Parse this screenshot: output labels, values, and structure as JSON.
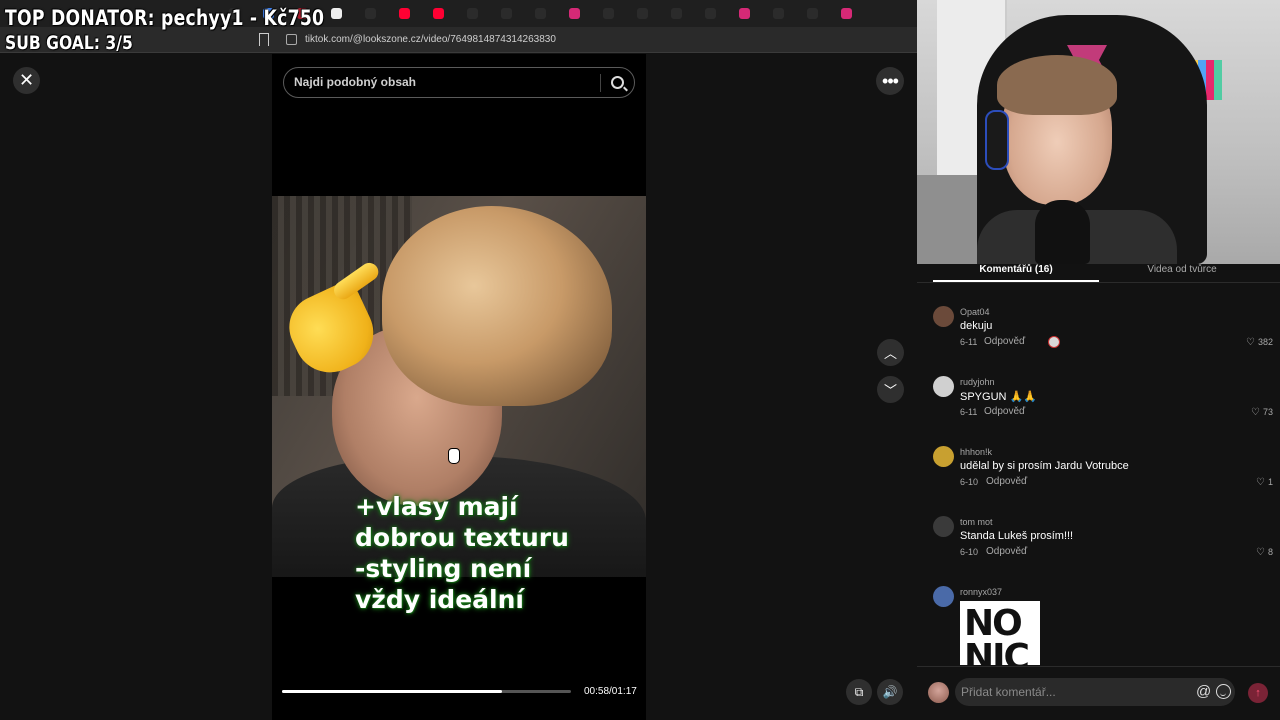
{
  "overlay": {
    "donator": "TOP DONATOR: pechyy1 - Kč750",
    "sub_goal": "SUB GOAL: 3/5"
  },
  "browser": {
    "url": "tiktok.com/@lookszone.cz/video/7649814874314263830",
    "tabs": [
      {
        "icon": "tiktok-icon",
        "color": "#2b2b2b"
      },
      {
        "icon": "google-icon",
        "color": "#4285f4"
      },
      {
        "icon": "site-icon",
        "color": "#b01e2e"
      },
      {
        "icon": "r-icon",
        "color": "#eeeeee"
      },
      {
        "icon": "tiktok-icon",
        "color": "#2b2b2b"
      },
      {
        "icon": "youtube-icon",
        "color": "#ff0033"
      },
      {
        "icon": "youtube-icon",
        "color": "#ff0033"
      },
      {
        "icon": "tiktok-icon",
        "color": "#2b2b2b"
      },
      {
        "icon": "tiktok-icon",
        "color": "#2b2b2b"
      },
      {
        "icon": "tiktok-icon",
        "color": "#2b2b2b"
      },
      {
        "icon": "instagram-icon",
        "color": "#d62976"
      },
      {
        "icon": "tiktok-icon",
        "color": "#2b2b2b"
      },
      {
        "icon": "tiktok-icon",
        "color": "#2b2b2b"
      },
      {
        "icon": "tiktok-icon",
        "color": "#2b2b2b"
      },
      {
        "icon": "tiktok-icon",
        "color": "#2b2b2b"
      },
      {
        "icon": "instagram-icon",
        "color": "#d62976"
      },
      {
        "icon": "tiktok-icon",
        "color": "#2b2b2b"
      },
      {
        "icon": "tiktok-icon",
        "color": "#2b2b2b"
      },
      {
        "icon": "instagram-icon",
        "color": "#d62976"
      }
    ]
  },
  "search": {
    "placeholder": "Najdi podobný obsah"
  },
  "video": {
    "caption": "+vlasy mají\ndobrou texturu\n-styling není\nvždy ideální",
    "current_time": "00:58",
    "duration": "01:17",
    "time_label": "00:58/01:17",
    "progress": 0.76
  },
  "panel": {
    "tab_comments": "Komentářů (16)",
    "tab_videos": "Videa od tvůrce",
    "reply_label": "Odpověď",
    "comments": [
      {
        "user": "Opat04",
        "text": "dekuju",
        "date": "6-11",
        "likes": "382",
        "avatar_color": "#6b4a3a"
      },
      {
        "user": "rudyjohn",
        "text": "SPYGUN 🙏🙏",
        "date": "6-11",
        "likes": "73",
        "avatar_color": "#d0d0d0"
      },
      {
        "user": "hhhon!k",
        "text": "udělal by si prosím Jardu Votrubce",
        "date": "6-10",
        "likes": "1",
        "avatar_color": "#c8a030"
      },
      {
        "user": "tom mot",
        "text": "Standa Lukeš prosím!!!",
        "date": "6-10",
        "likes": "8",
        "avatar_color": "#3a3a3a"
      },
      {
        "user": "ronnyx037",
        "image_text": "NO NIC",
        "avatar_color": "#4a6aa8"
      }
    ],
    "input_placeholder": "Přidat komentář..."
  }
}
